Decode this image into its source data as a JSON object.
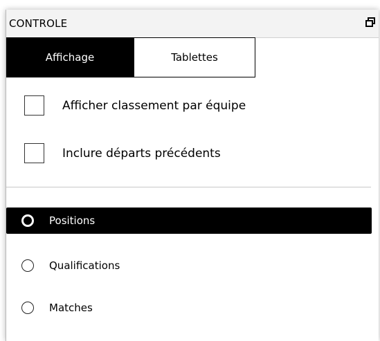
{
  "panel": {
    "title": "CONTROLE",
    "restore_icon": "restore-window-icon"
  },
  "tabs": [
    {
      "label": "Affichage",
      "active": true
    },
    {
      "label": "Tablettes",
      "active": false
    }
  ],
  "options": [
    {
      "label": "Afficher classement par équipe",
      "checked": false
    },
    {
      "label": "Inclure départs précédents",
      "checked": false
    }
  ],
  "modes": [
    {
      "label": "Positions",
      "selected": true
    },
    {
      "label": "Qualifications",
      "selected": false
    },
    {
      "label": "Matches",
      "selected": false
    }
  ],
  "colors": {
    "selected_bg": "#000000",
    "selected_fg": "#ffffff"
  }
}
